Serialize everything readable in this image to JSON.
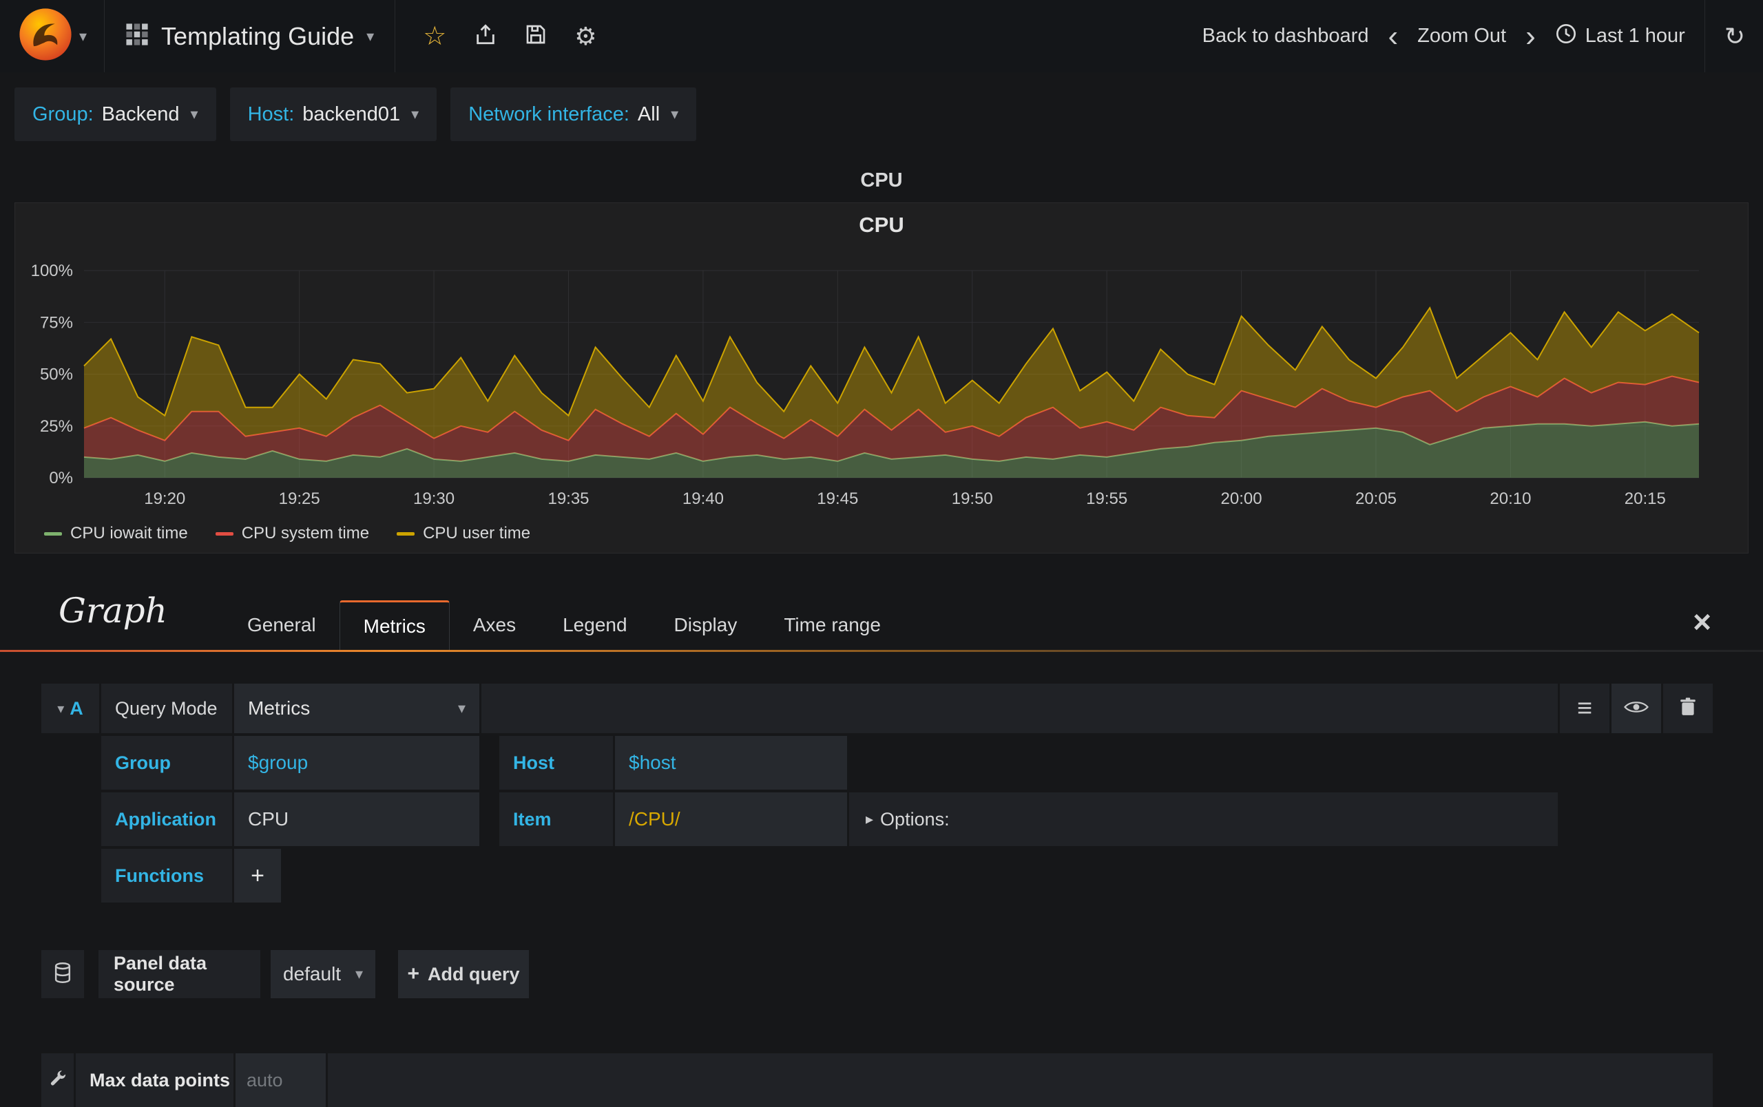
{
  "colors": {
    "accent": "#33b5e5",
    "tab_active_border": "#e8692d",
    "series_green": "#7eb26d",
    "series_red": "#e24d42",
    "series_yellow": "#cca300"
  },
  "icons": {
    "caret_down": "▾",
    "star": "☆",
    "gear": "⚙",
    "refresh": "↻",
    "chevron_left": "‹",
    "chevron_right": "›",
    "hamburger": "≡",
    "plus": "+",
    "close": "×",
    "options_caret": "▸"
  },
  "navbar": {
    "dashboard_title": "Templating Guide",
    "back_to_dashboard": "Back to dashboard",
    "zoom_out": "Zoom Out",
    "time_range": "Last 1 hour"
  },
  "template_vars": [
    {
      "label": "Group:",
      "value": "Backend"
    },
    {
      "label": "Host:",
      "value": "backend01"
    },
    {
      "label": "Network interface:",
      "value": "All"
    }
  ],
  "panel": {
    "header": "CPU",
    "title": "CPU"
  },
  "chart_data": {
    "type": "area",
    "stacked": true,
    "title": "CPU",
    "ylim": [
      0,
      100
    ],
    "y_ticks": [
      "0%",
      "25%",
      "50%",
      "75%",
      "100%"
    ],
    "x_domain_minutes": [
      0,
      60
    ],
    "x_ticks": [
      {
        "minute": 3,
        "label": "19:20"
      },
      {
        "minute": 8,
        "label": "19:25"
      },
      {
        "minute": 13,
        "label": "19:30"
      },
      {
        "minute": 18,
        "label": "19:35"
      },
      {
        "minute": 23,
        "label": "19:40"
      },
      {
        "minute": 28,
        "label": "19:45"
      },
      {
        "minute": 33,
        "label": "19:50"
      },
      {
        "minute": 38,
        "label": "19:55"
      },
      {
        "minute": 43,
        "label": "20:00"
      },
      {
        "minute": 48,
        "label": "20:05"
      },
      {
        "minute": 53,
        "label": "20:10"
      },
      {
        "minute": 58,
        "label": "20:15"
      }
    ],
    "series": [
      {
        "name": "CPU iowait time",
        "color": "#7eb26d",
        "values": [
          10,
          9,
          11,
          8,
          12,
          10,
          9,
          13,
          9,
          8,
          11,
          10,
          14,
          9,
          8,
          10,
          12,
          9,
          8,
          11,
          10,
          9,
          12,
          8,
          10,
          11,
          9,
          10,
          8,
          12,
          9,
          10,
          11,
          9,
          8,
          10,
          9,
          11,
          10,
          12,
          14,
          15,
          17,
          18,
          20,
          21,
          22,
          23,
          24,
          22,
          16,
          20,
          24,
          25,
          26,
          26,
          25,
          26,
          27,
          25,
          26
        ]
      },
      {
        "name": "CPU system time",
        "color": "#e24d42",
        "values": [
          14,
          20,
          12,
          10,
          20,
          22,
          11,
          9,
          15,
          12,
          18,
          25,
          13,
          10,
          17,
          12,
          20,
          14,
          10,
          22,
          16,
          11,
          19,
          13,
          24,
          15,
          10,
          18,
          12,
          21,
          14,
          23,
          11,
          16,
          12,
          19,
          25,
          13,
          17,
          11,
          20,
          15,
          12,
          24,
          18,
          13,
          21,
          14,
          10,
          17,
          26,
          12,
          15,
          19,
          13,
          22,
          16,
          20,
          18,
          24,
          20
        ]
      },
      {
        "name": "CPU user time",
        "color": "#cca300",
        "values": [
          30,
          38,
          16,
          12,
          36,
          32,
          14,
          12,
          26,
          18,
          28,
          20,
          14,
          24,
          33,
          15,
          27,
          18,
          12,
          30,
          22,
          14,
          28,
          16,
          34,
          20,
          13,
          26,
          16,
          30,
          18,
          35,
          14,
          22,
          16,
          26,
          38,
          18,
          24,
          14,
          28,
          20,
          16,
          36,
          26,
          18,
          30,
          20,
          14,
          24,
          40,
          16,
          20,
          26,
          18,
          32,
          22,
          34,
          26,
          30,
          24
        ]
      }
    ],
    "legend_position": "bottom-left"
  },
  "editor": {
    "panel_type": "Graph",
    "tabs": [
      "General",
      "Metrics",
      "Axes",
      "Legend",
      "Display",
      "Time range"
    ],
    "active_tab": "Metrics",
    "query": {
      "ref_id": "A",
      "query_mode_label": "Query Mode",
      "query_mode_value": "Metrics",
      "group_label": "Group",
      "group_value": "$group",
      "host_label": "Host",
      "host_value": "$host",
      "application_label": "Application",
      "application_value": "CPU",
      "item_label": "Item",
      "item_value": "/CPU/",
      "options_label": "Options:",
      "functions_label": "Functions"
    },
    "datasource": {
      "label": "Panel data source",
      "value": "default",
      "add_query": "Add query"
    },
    "max_data_points": {
      "label": "Max data points",
      "placeholder": "auto"
    }
  }
}
